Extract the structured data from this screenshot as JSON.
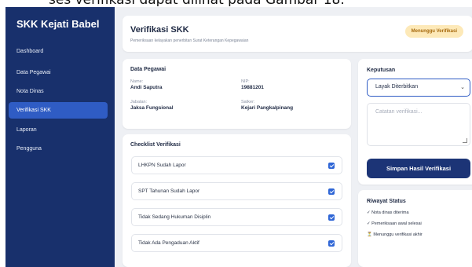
{
  "top_caption": "ses verifikasi dapat dilihat pada Gambar 18.",
  "sidebar": {
    "brand": "SKK Kejati Babel",
    "items": [
      {
        "label": "Dashboard",
        "active": false
      },
      {
        "label": "Data Pegawai",
        "active": false
      },
      {
        "label": "Nota Dinas",
        "active": false
      },
      {
        "label": "Verifikasi SKK",
        "active": true
      },
      {
        "label": "Laporan",
        "active": false
      },
      {
        "label": "Pengguna",
        "active": false
      }
    ]
  },
  "header": {
    "title": "Verifikasi SKK",
    "subtitle": "Pemeriksaan kelayakan penerbitan Surat Keterangan Kepegawaian",
    "status_badge": "Menunggu Verifikasi"
  },
  "pegawai": {
    "title": "Data Pegawai",
    "name_label": "Name:",
    "name_value": "Andi Saputra",
    "nip_label": "NIP:",
    "nip_value": "19881201",
    "jabatan_label": "Jabatan:",
    "jabatan_value": "Jaksa Fungsional",
    "satker_label": "Satker:",
    "satker_value": "Kejari Pangkalpinang"
  },
  "checklist": {
    "title": "Checklist Verifikasi",
    "items": [
      {
        "label": "LHKPN Sudah Lapor",
        "checked": true
      },
      {
        "label": "SPT Tahunan Sudah Lapor",
        "checked": true
      },
      {
        "label": "Tidak Sedang Hukuman Disiplin",
        "checked": true
      },
      {
        "label": "Tidak Ada Pengaduan Aktif",
        "checked": true
      }
    ]
  },
  "keputusan": {
    "title": "Keputusan",
    "selected": "Layak Diterbitkan",
    "note_placeholder": "Catatan verifikasi...",
    "save_label": "Simpan Hasil Verifikasi"
  },
  "riwayat": {
    "title": "Riwayat Status",
    "entries": [
      "✓ Nota dinas diterima",
      "✓ Pemeriksaan awal selesai",
      "⏳ Menunggu verifikasi akhir"
    ]
  },
  "colors": {
    "sidebar_bg": "#18306c",
    "active_item": "#2f5cc4",
    "badge_bg": "#fde9b8",
    "primary_button": "#1c3476"
  }
}
